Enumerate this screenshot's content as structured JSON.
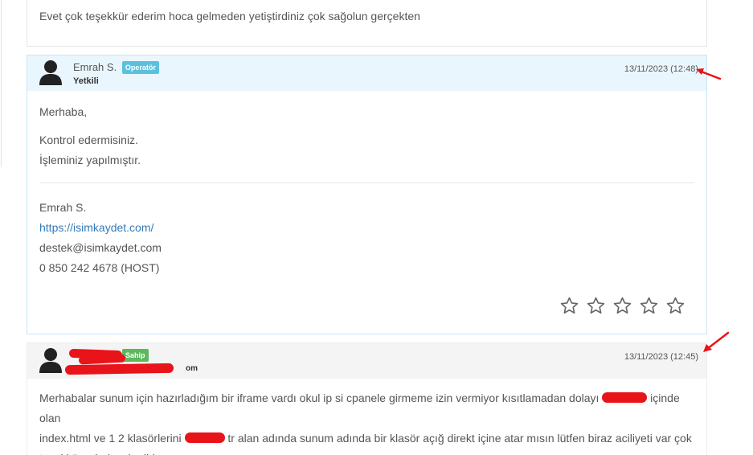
{
  "previous_message": {
    "text": "Evet çok teşekkür ederim hoca gelmeden yetiştirdiniz çok sağolun gerçekten"
  },
  "operator_message": {
    "author": "Emrah S.",
    "badge": "Operatör",
    "role": "Yetkili",
    "date": "13/11/2023 (12:48)",
    "lines": [
      "Merhaba,",
      "Kontrol edermisiniz.",
      "İşleminiz yapılmıştır."
    ],
    "signature": {
      "name": "Emrah S.",
      "url": "https://isimkaydet.com/",
      "email": "destek@isimkaydet.com",
      "phone": "0 850 242 4678 (HOST)"
    },
    "rating": {
      "label": "star-rating",
      "value": 0,
      "max": 5
    }
  },
  "customer_message": {
    "badge": "Sahip",
    "email_suffix": "om",
    "date": "13/11/2023 (12:45)",
    "text_part1": "Merhabalar sunum için hazırladığım bir iframe vardı okul ip si cpanele girmeme izin vermiyor kısıtlamadan dolayı",
    "text_part2": "içinde olan",
    "text_part3": "index.html ve 1 2 klasörlerini",
    "text_part4": "tr alan adında sunum adında bir klasör açığ direkt içine atar mısın lütfen biraz aciliyeti var çok",
    "text_part5": "teşekkür ederim şimdiden."
  },
  "colors": {
    "operator_header_bg": "#eaf6fd",
    "operator_border": "#c9e6f4",
    "badge_operator": "#5bc0de",
    "badge_owner": "#5cb85c",
    "link": "#337ab7",
    "annotation_red": "#e8141a"
  }
}
